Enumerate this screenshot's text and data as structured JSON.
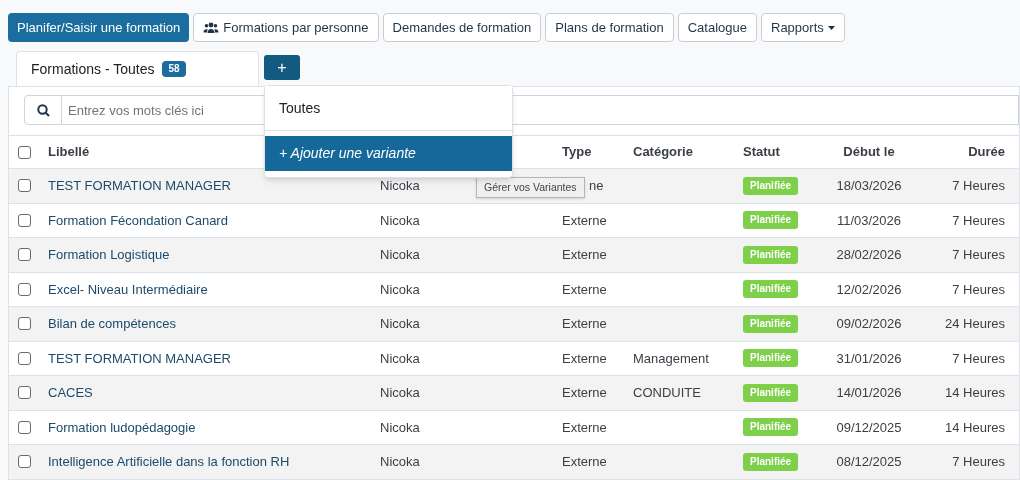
{
  "toolbar": [
    {
      "label": "Planifer/Saisir une formation",
      "kind": "primary"
    },
    {
      "label": "Formations par personne",
      "kind": "people"
    },
    {
      "label": "Demandes de formation",
      "kind": "plain"
    },
    {
      "label": "Plans de formation",
      "kind": "plain"
    },
    {
      "label": "Catalogue",
      "kind": "plain"
    },
    {
      "label": "Rapports",
      "kind": "dropdown"
    }
  ],
  "tabs": [
    {
      "label": "Formations - Toutes",
      "count": "58",
      "selected": true
    }
  ],
  "add_button": {
    "label": "+"
  },
  "dropdown": {
    "items": [
      {
        "label": "Toutes",
        "selected": false
      },
      {
        "label": "+ Ajouter une variante",
        "selected": true
      }
    ]
  },
  "tooltip": {
    "text": "Gérer vos Variantes"
  },
  "search": {
    "placeholder": "Entrez vos mots clés ici"
  },
  "table": {
    "select_all_checked": false,
    "header": {
      "libelle": "Libellé",
      "type": "Type",
      "categorie": "Catégorie",
      "statut": "Statut",
      "debut": "Début le",
      "duree": "Durée"
    },
    "rows": [
      {
        "checked": false,
        "libelle": "TEST FORMATION MANAGER",
        "column_2": "Nicoka",
        "type": "ne",
        "categorie": "",
        "statut": "Planifiée",
        "debut": "18/03/2026",
        "duree": "7 Heures"
      },
      {
        "checked": false,
        "libelle": "Formation Fécondation Canard",
        "column_2": "Nicoka",
        "type": "Externe",
        "categorie": "",
        "statut": "Planifiée",
        "debut": "11/03/2026",
        "duree": "7 Heures"
      },
      {
        "checked": false,
        "libelle": "Formation Logistique",
        "column_2": "Nicoka",
        "type": "Externe",
        "categorie": "",
        "statut": "Planifiée",
        "debut": "28/02/2026",
        "duree": "7 Heures"
      },
      {
        "checked": false,
        "libelle": "Excel- Niveau Intermédiaire",
        "column_2": "Nicoka",
        "type": "Externe",
        "categorie": "",
        "statut": "Planifiée",
        "debut": "12/02/2026",
        "duree": "7 Heures"
      },
      {
        "checked": false,
        "libelle": "Bilan de compétences",
        "column_2": "Nicoka",
        "type": "Externe",
        "categorie": "",
        "statut": "Planifiée",
        "debut": "09/02/2026",
        "duree": "24 Heures"
      },
      {
        "checked": false,
        "libelle": "TEST FORMATION MANAGER",
        "column_2": "Nicoka",
        "type": "Externe",
        "categorie": "Management",
        "statut": "Planifiée",
        "debut": "31/01/2026",
        "duree": "7 Heures"
      },
      {
        "checked": false,
        "libelle": "CACES",
        "column_2": "Nicoka",
        "type": "Externe",
        "categorie": "CONDUITE",
        "statut": "Planifiée",
        "debut": "14/01/2026",
        "duree": "14 Heures"
      },
      {
        "checked": false,
        "libelle": "Formation ludopédagogie",
        "column_2": "Nicoka",
        "type": "Externe",
        "categorie": "",
        "statut": "Planifiée",
        "debut": "09/12/2025",
        "duree": "14 Heures"
      },
      {
        "checked": false,
        "libelle": "Intelligence Artificielle dans la fonction RH",
        "column_2": "Nicoka",
        "type": "Externe",
        "categorie": "",
        "statut": "Planifiée",
        "debut": "08/12/2025",
        "duree": "7 Heures"
      }
    ]
  }
}
